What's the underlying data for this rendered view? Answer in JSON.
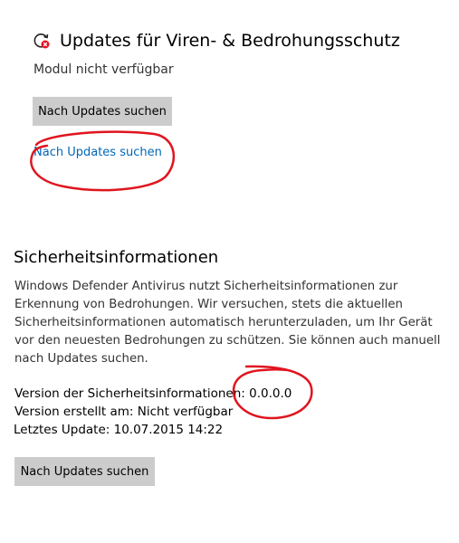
{
  "updates_section": {
    "icon": "sync-error-icon",
    "title": "Updates für Viren- & Bedrohungsschutz",
    "status": "Modul nicht verfügbar",
    "button_label": "Nach Updates suchen",
    "link_label": "Nach Updates suchen"
  },
  "security_info": {
    "title": "Sicherheitsinformationen",
    "description": "Windows Defender Antivirus nutzt Sicherheitsinformationen zur Erkennung von Bedrohungen. Wir versuchen, stets die aktuellen Sicherheitsinformationen automatisch herunterzuladen, um Ihr Gerät vor den neuesten Bedrohungen zu schützen. Sie können auch manuell nach Updates suchen.",
    "version_label": "Version der Sicherheitsinformationen:",
    "version_value": "0.0.0.0",
    "created_line": "Version erstellt am: Nicht verfügbar",
    "last_update_line": "Letztes Update: 10.07.2015 14:22",
    "button_label": "Nach Updates suchen"
  },
  "colors": {
    "link": "#0067b8",
    "button_bg": "#cccccc",
    "error_badge": "#e81123",
    "annotation": "#e0141e"
  }
}
